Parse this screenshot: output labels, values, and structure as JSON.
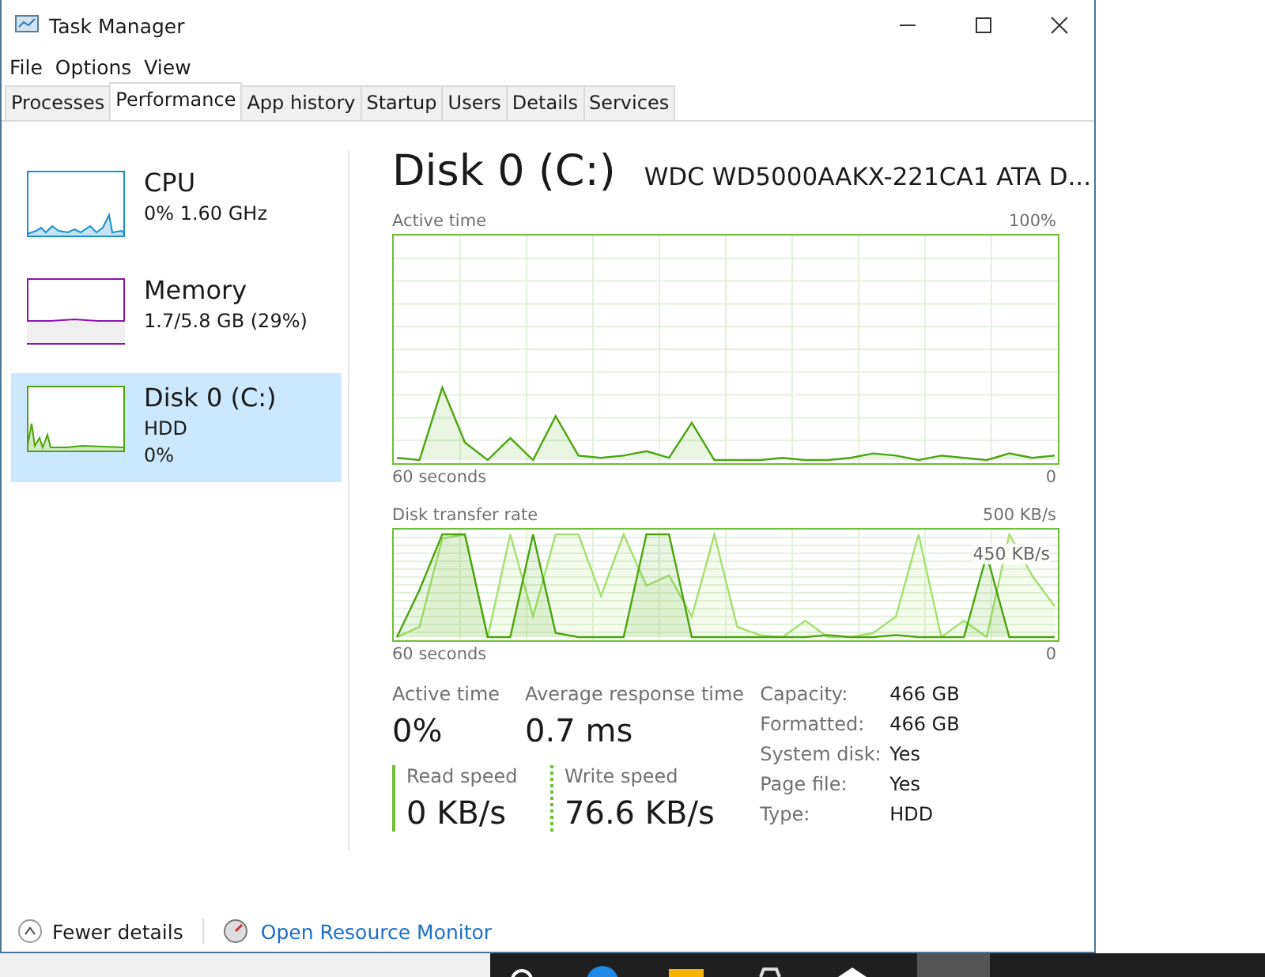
{
  "window": {
    "title": "Task Manager"
  },
  "menu": [
    "File",
    "Options",
    "View"
  ],
  "tabs": [
    {
      "label": "Processes",
      "selected": false
    },
    {
      "label": "Performance",
      "selected": true
    },
    {
      "label": "App history",
      "selected": false
    },
    {
      "label": "Startup",
      "selected": false
    },
    {
      "label": "Users",
      "selected": false
    },
    {
      "label": "Details",
      "selected": false
    },
    {
      "label": "Services",
      "selected": false
    }
  ],
  "sidebar": {
    "items": [
      {
        "name": "CPU",
        "lines": [
          "0%  1.60 GHz"
        ],
        "color": "#1c8fd1",
        "selected": false
      },
      {
        "name": "Memory",
        "lines": [
          "1.7/5.8 GB (29%)"
        ],
        "color": "#8b12ae",
        "selected": false
      },
      {
        "name": "Disk 0 (C:)",
        "lines": [
          "HDD",
          "0%"
        ],
        "color": "#4ca40e",
        "selected": true
      }
    ]
  },
  "detail": {
    "title": "Disk 0 (C:)",
    "model": "WDC WD5000AAKX-221CA1 ATA D...",
    "charts": [
      {
        "title": "Active time",
        "max_label": "100%",
        "xlabel": "60 seconds",
        "min_label": "0"
      },
      {
        "title": "Disk transfer rate",
        "max_label": "500 KB/s",
        "scale_label": "450 KB/s",
        "xlabel": "60 seconds",
        "min_label": "0"
      }
    ],
    "stats": [
      {
        "label": "Active time",
        "value": "0%"
      },
      {
        "label": "Average response time",
        "value": "0.7 ms"
      }
    ],
    "speeds": [
      {
        "label": "Read speed",
        "value": "0 KB/s",
        "kind": "solid"
      },
      {
        "label": "Write speed",
        "value": "76.6 KB/s",
        "kind": "dotted"
      }
    ],
    "properties": [
      {
        "label": "Capacity:",
        "value": "466 GB"
      },
      {
        "label": "Formatted:",
        "value": "466 GB"
      },
      {
        "label": "System disk:",
        "value": "Yes"
      },
      {
        "label": "Page file:",
        "value": "Yes"
      },
      {
        "label": "Type:",
        "value": "HDD"
      }
    ]
  },
  "footer": {
    "fewer_details": "Fewer details",
    "resource_monitor": "Open Resource Monitor"
  }
}
